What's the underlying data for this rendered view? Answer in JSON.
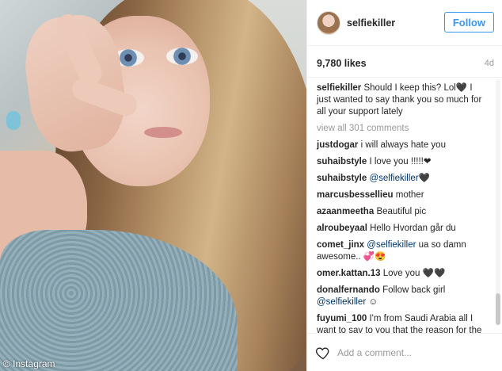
{
  "photo": {
    "watermark": "© Instagram"
  },
  "header": {
    "username": "selfiekiller",
    "follow_label": "Follow"
  },
  "meta": {
    "likes": "9,780 likes",
    "age": "4d"
  },
  "caption": {
    "username": "selfiekiller",
    "text": "Should I keep this? Lol🖤 I just wanted to say thank you so much for all your support lately"
  },
  "view_all": "view all 301 comments",
  "comments": [
    {
      "user": "justdogar",
      "text": "i will always hate you"
    },
    {
      "user": "suhaibstyle",
      "text": "I love you !!!!!❤"
    },
    {
      "user": "suhaibstyle",
      "mention": "@selfiekiller",
      "text": "🖤"
    },
    {
      "user": "marcusbessellieu",
      "text": "mother"
    },
    {
      "user": "azaanmeetha",
      "text": "Beautiful pic"
    },
    {
      "user": "alroubeyaal",
      "text": "Hello Hvordan går du"
    },
    {
      "user": "comet_jinx",
      "mention": "@selfiekiller",
      "text": "ua so damn awesome.. 💞😍"
    },
    {
      "user": "omer.kattan.13",
      "text": "Love you 🖤🖤"
    },
    {
      "user": "donalfernando",
      "text": "Follow back girl",
      "mention2": "@selfiekiller",
      "text2": "☺"
    },
    {
      "user": "fuyumi_100",
      "text": "I'm from Saudi Arabia all I want to say to you that the reason for the arrest of Abu age of sexual harassment"
    }
  ],
  "footer": {
    "placeholder": "Add a comment..."
  },
  "colors": {
    "accent": "#3897f0",
    "mention": "#003569",
    "muted": "#999999"
  }
}
